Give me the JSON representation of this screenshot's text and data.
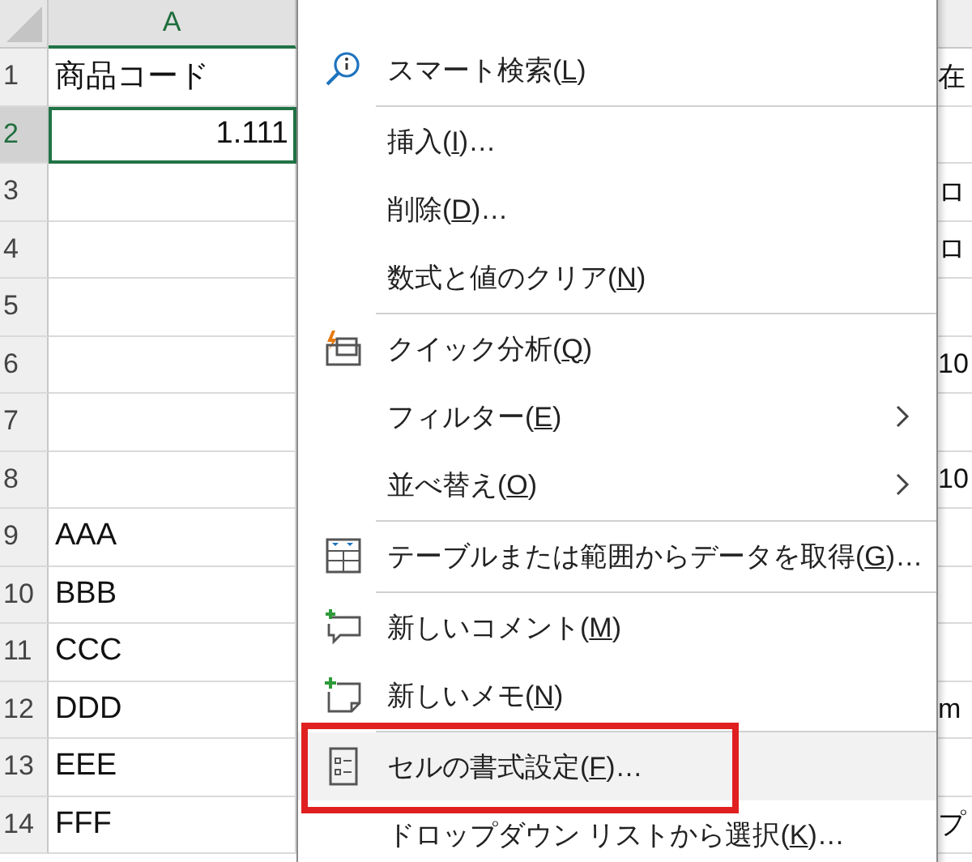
{
  "sheet": {
    "columns": [
      {
        "label": "A",
        "selected": true
      }
    ],
    "rows": [
      {
        "number": "1",
        "selected": false,
        "cell_a": "商品コード",
        "kind": "text",
        "cell_c": "在"
      },
      {
        "number": "2",
        "selected": true,
        "cell_a": "1.111",
        "kind": "number"
      },
      {
        "number": "3",
        "selected": false,
        "cell_c": "ロ"
      },
      {
        "number": "4",
        "selected": false,
        "cell_c": "ロ"
      },
      {
        "number": "5",
        "selected": false
      },
      {
        "number": "6",
        "selected": false,
        "cell_c": "10"
      },
      {
        "number": "7",
        "selected": false
      },
      {
        "number": "8",
        "selected": false,
        "cell_c": "10"
      },
      {
        "number": "9",
        "selected": false,
        "cell_a": "AAA",
        "kind": "text"
      },
      {
        "number": "10",
        "selected": false,
        "cell_a": "BBB",
        "kind": "text"
      },
      {
        "number": "11",
        "selected": false,
        "cell_a": "CCC",
        "kind": "text"
      },
      {
        "number": "12",
        "selected": false,
        "cell_a": "DDD",
        "kind": "text",
        "cell_c": "m"
      },
      {
        "number": "13",
        "selected": false,
        "cell_a": "EEE",
        "kind": "text"
      },
      {
        "number": "14",
        "selected": false,
        "cell_a": "FFF",
        "kind": "text",
        "cell_c": "プ"
      }
    ]
  },
  "context_menu": {
    "items": [
      {
        "kind": "lookup",
        "before": "スマート検索(",
        "key": "L",
        "after": ")",
        "submenu": false,
        "highlighted": false
      },
      {
        "kind": "separator"
      },
      {
        "kind": "text",
        "before": "挿入(",
        "key": "I",
        "after": ")…",
        "submenu": false,
        "highlighted": false
      },
      {
        "kind": "text",
        "before": "削除(",
        "key": "D",
        "after": ")…",
        "submenu": false,
        "highlighted": false
      },
      {
        "kind": "text",
        "before": "数式と値のクリア(",
        "key": "N",
        "after": ")",
        "submenu": false,
        "highlighted": false
      },
      {
        "kind": "separator"
      },
      {
        "kind": "analysis",
        "before": "クイック分析(",
        "key": "Q",
        "after": ")",
        "submenu": false,
        "highlighted": false
      },
      {
        "kind": "text",
        "before": "フィルター(",
        "key": "E",
        "after": ")",
        "submenu": true,
        "highlighted": false
      },
      {
        "kind": "text",
        "before": "並べ替え(",
        "key": "O",
        "after": ")",
        "submenu": true,
        "highlighted": false
      },
      {
        "kind": "separator"
      },
      {
        "kind": "table",
        "before": "テーブルまたは範囲からデータを取得(",
        "key": "G",
        "after": ")…",
        "submenu": false,
        "highlighted": false
      },
      {
        "kind": "separator"
      },
      {
        "kind": "comment",
        "before": "新しいコメント(",
        "key": "M",
        "after": ")",
        "submenu": false,
        "highlighted": false
      },
      {
        "kind": "note",
        "before": "新しいメモ(",
        "key": "N",
        "after": ")",
        "submenu": false,
        "highlighted": false
      },
      {
        "kind": "separator"
      },
      {
        "kind": "format",
        "before": "セルの書式設定(",
        "key": "F",
        "after": ")…",
        "submenu": false,
        "highlighted": true
      },
      {
        "kind": "text",
        "before": "ドロップダウン リストから選択(",
        "key": "K",
        "after": ")…",
        "submenu": false,
        "highlighted": false
      }
    ]
  }
}
